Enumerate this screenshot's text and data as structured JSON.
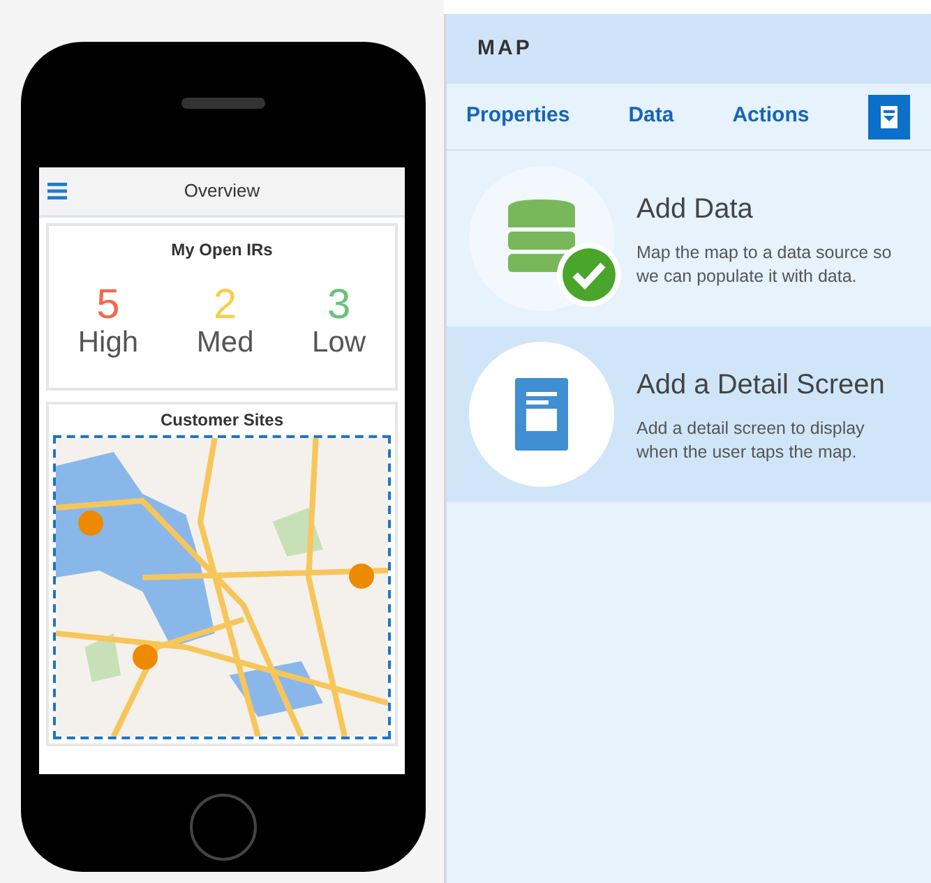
{
  "phone": {
    "header": {
      "title": "Overview"
    },
    "open_irs": {
      "title": "My Open IRs",
      "stats": [
        {
          "count": "5",
          "label": "High",
          "color": "#f0694d"
        },
        {
          "count": "2",
          "label": "Med",
          "color": "#f7cf4a"
        },
        {
          "count": "3",
          "label": "Low",
          "color": "#6cc17b"
        }
      ]
    },
    "customer_sites": {
      "title": "Customer Sites"
    }
  },
  "panel": {
    "title": "MAP",
    "tabs": [
      {
        "label": "Properties",
        "kind": "text",
        "selected": false
      },
      {
        "label": "Data",
        "kind": "text",
        "selected": false
      },
      {
        "label": "Actions",
        "kind": "text",
        "selected": false
      },
      {
        "kind": "icon",
        "selected": true
      }
    ],
    "actions": [
      {
        "kind": "data",
        "title": "Add Data",
        "description": "Map the map to a data source so we can populate it with data.",
        "done": true,
        "selected": false
      },
      {
        "kind": "detail",
        "title": "Add a Detail Screen",
        "description": "Add a detail screen to display when the user taps the map.",
        "done": false,
        "selected": true
      }
    ]
  }
}
